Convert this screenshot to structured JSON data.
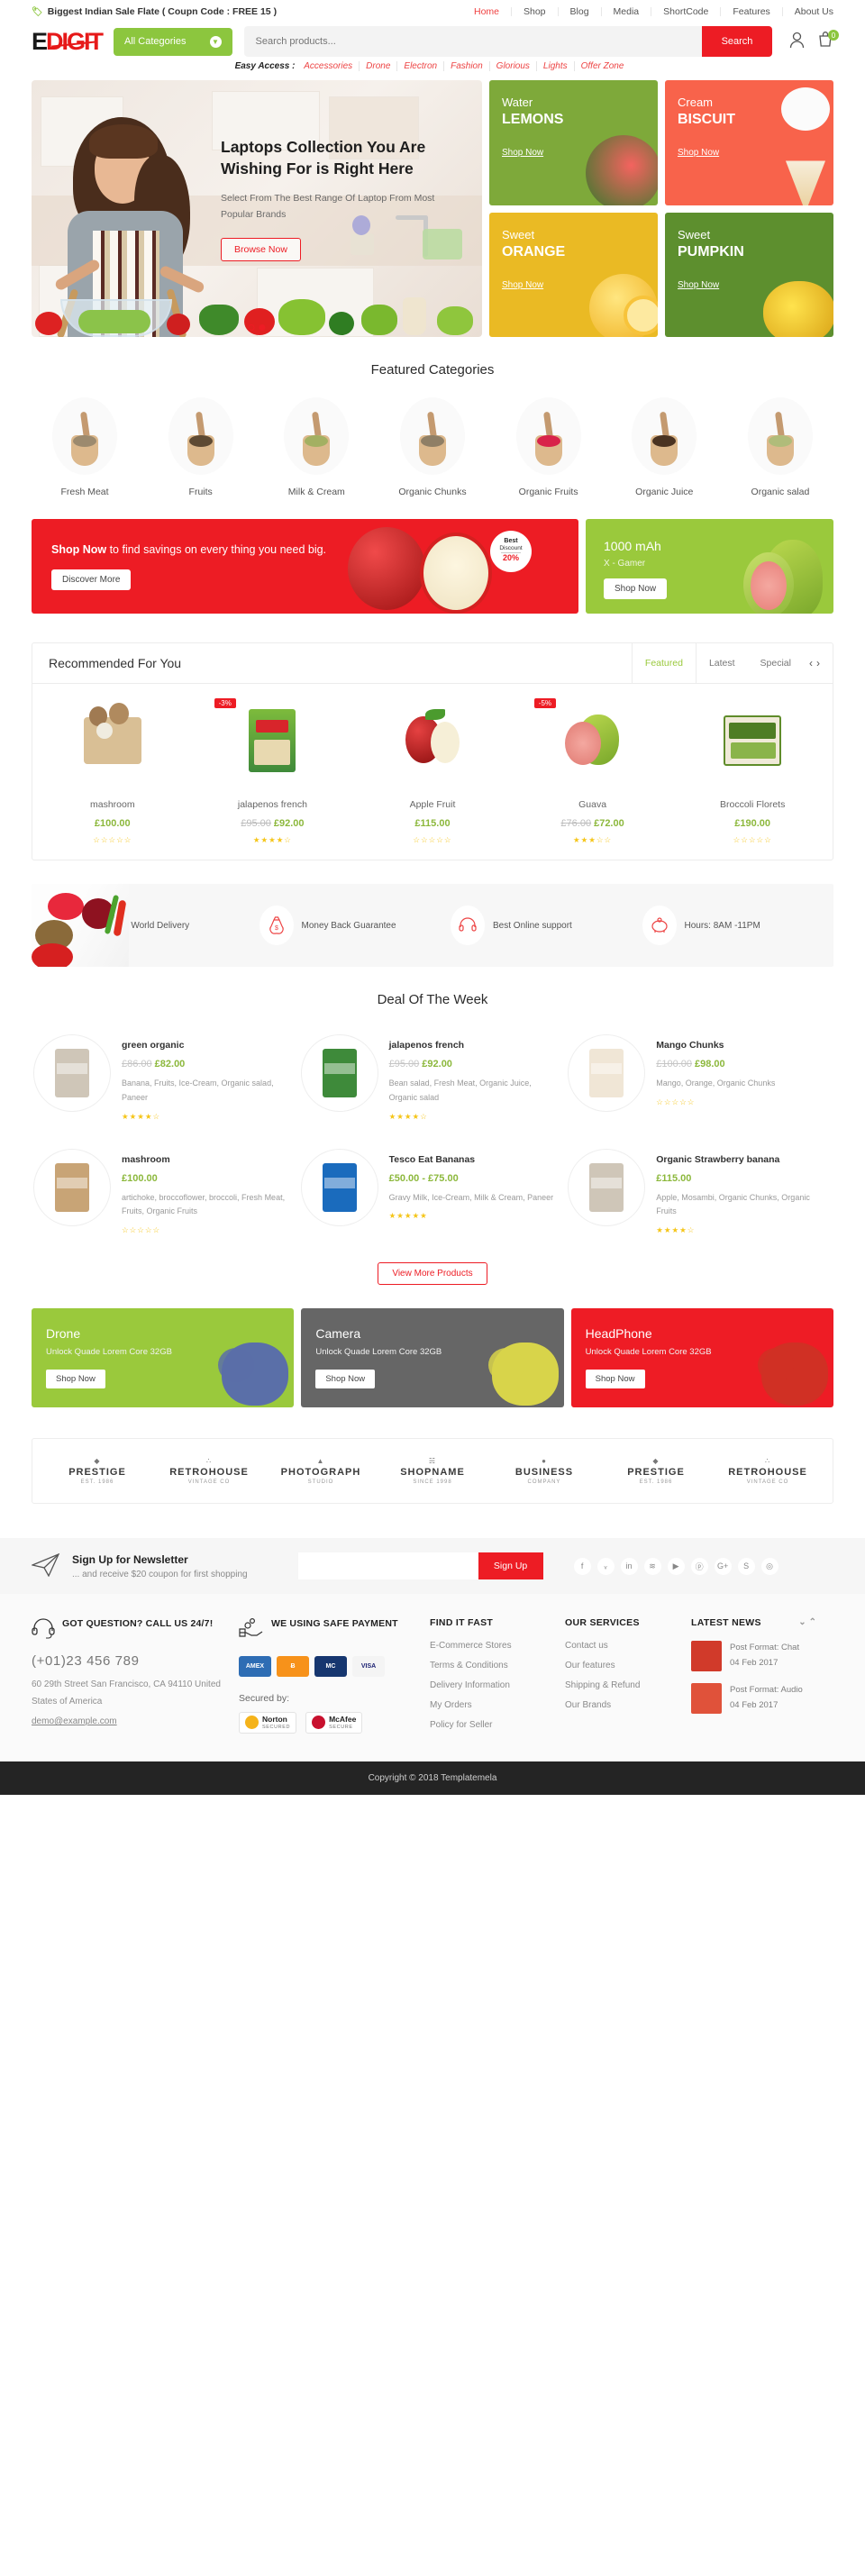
{
  "topbar": {
    "announcement": "Biggest Indian Sale Flate ( Coupn Code : FREE 15 )",
    "nav": [
      {
        "label": "Home",
        "active": true
      },
      {
        "label": "Shop",
        "active": false
      },
      {
        "label": "Blog",
        "active": false
      },
      {
        "label": "Media",
        "active": false
      },
      {
        "label": "ShortCode",
        "active": false
      },
      {
        "label": "Features",
        "active": false
      },
      {
        "label": "About Us",
        "active": false
      }
    ]
  },
  "header": {
    "logo_e": "E",
    "logo_rest": "DIGIT",
    "category_label": "All Categories",
    "search_placeholder": "Search products...",
    "search_value": "",
    "search_button": "Search",
    "cart_count": "0"
  },
  "easy_access": {
    "label": "Easy Access :",
    "links": [
      "Accessories",
      "Drone",
      "Electron",
      "Fashion",
      "Glorious",
      "Lights",
      "Offer Zone"
    ]
  },
  "hero": {
    "heading": "Laptops Collection You Are Wishing For is Right Here",
    "subtext": "Select From The Best Range Of Laptop From Most Popular Brands",
    "button": "Browse Now"
  },
  "promos": [
    {
      "small": "Water",
      "big": "LEMONS",
      "cta": "Shop Now",
      "color": "#7ea93a"
    },
    {
      "small": "Cream",
      "big": "BISCUIT",
      "cta": "Shop Now",
      "color": "#f8634b"
    },
    {
      "small": "Sweet",
      "big": "ORANGE",
      "cta": "Shop Now",
      "color": "#eaba24"
    },
    {
      "small": "Sweet",
      "big": "PUMPKIN",
      "cta": "Shop Now",
      "color": "#5d8f2e"
    }
  ],
  "featured": {
    "title": "Featured Categories",
    "items": [
      {
        "label": "Fresh Meat",
        "color": "#9c8a6e"
      },
      {
        "label": "Fruits",
        "color": "#5e4a33"
      },
      {
        "label": "Milk & Cream",
        "color": "#a3b062"
      },
      {
        "label": "Organic Chunks",
        "color": "#8f7f66"
      },
      {
        "label": "Organic Fruits",
        "color": "#d8234a"
      },
      {
        "label": "Organic Juice",
        "color": "#4a3322"
      },
      {
        "label": "Organic salad",
        "color": "#b0bc7a"
      }
    ]
  },
  "big_promo": {
    "left_text_bold": "Shop Now",
    "left_text": " to find savings on every thing you need big.",
    "left_button": "Discover More",
    "badge_line1": "Best",
    "badge_line2": "Discount",
    "badge_value": "20%",
    "right_title": "1000 mAh",
    "right_sub": "X - Gamer",
    "right_button": "Shop Now"
  },
  "recommended": {
    "title": "Recommended For You",
    "tabs": [
      {
        "label": "Featured",
        "active": true
      },
      {
        "label": "Latest",
        "active": false
      },
      {
        "label": "Special",
        "active": false
      }
    ],
    "prev": "‹",
    "next": "›",
    "products": [
      {
        "name": "mashroom",
        "price": "£100.00",
        "old_price": "",
        "discount": "",
        "stars": 0
      },
      {
        "name": "jalapenos french",
        "price": "£92.00",
        "old_price": "£95.00",
        "discount": "-3%",
        "stars": 4
      },
      {
        "name": "Apple Fruit",
        "price": "£115.00",
        "old_price": "",
        "discount": "",
        "stars": 0
      },
      {
        "name": "Guava",
        "price": "£72.00",
        "old_price": "£76.00",
        "discount": "-5%",
        "stars": 3
      },
      {
        "name": "Broccoli Florets",
        "price": "£190.00",
        "old_price": "",
        "discount": "",
        "stars": 0
      }
    ]
  },
  "services": [
    {
      "label": "Free World Delivery",
      "icon": "truck-icon"
    },
    {
      "label": "Money Back Guarantee",
      "icon": "money-bag-icon"
    },
    {
      "label": "Best Online support",
      "icon": "headset-icon"
    },
    {
      "label": "Hours: 8AM -11PM",
      "icon": "piggy-bank-icon"
    }
  ],
  "deals": {
    "title": "Deal Of The Week",
    "items": [
      {
        "name": "green organic",
        "price": "£82.00",
        "old_price": "£86.00",
        "cats": "Banana, Fruits, Ice-Cream, Organic salad, Paneer",
        "stars": 4,
        "img": "#cfc6b8"
      },
      {
        "name": "jalapenos french",
        "price": "£92.00",
        "old_price": "£95.00",
        "cats": "Bean salad, Fresh Meat, Organic Juice, Organic salad",
        "stars": 4,
        "img": "#3e8a3a"
      },
      {
        "name": "Mango Chunks",
        "price": "£98.00",
        "old_price": "£100.00",
        "cats": "Mango, Orange, Organic Chunks",
        "stars": 0,
        "img": "#f0e6d6"
      },
      {
        "name": "mashroom",
        "price": "£100.00",
        "old_price": "",
        "cats": "artichoke, broccoflower, broccoli, Fresh Meat, Fruits, Organic Fruits",
        "stars": 0,
        "img": "#c8a476"
      },
      {
        "name": "Tesco Eat Bananas",
        "price": "£50.00 - £75.00",
        "old_price": "",
        "cats": "Gravy Milk, Ice-Cream, Milk & Cream, Paneer",
        "stars": 5,
        "img": "#1a6bbd"
      },
      {
        "name": "Organic Strawberry banana",
        "price": "£115.00",
        "old_price": "",
        "cats": "Apple, Mosambi, Organic Chunks, Organic Fruits",
        "stars": 4,
        "img": "#cfc6b8"
      }
    ],
    "view_more": "View More Products"
  },
  "cat_banners": [
    {
      "title": "Drone",
      "sub": "Unlock Quade Lorem Core 32GB",
      "cta": "Shop Now",
      "color": "#9ac93c",
      "fruit": "#5a6fa8"
    },
    {
      "title": "Camera",
      "sub": "Unlock Quade Lorem Core 32GB",
      "cta": "Shop Now",
      "color": "#666666",
      "fruit": "#d8d44a"
    },
    {
      "title": "HeadPhone",
      "sub": "Unlock Quade Lorem Core 32GB",
      "cta": "Shop Now",
      "color": "#ee1c25",
      "fruit": "#d03024"
    }
  ],
  "brands": [
    {
      "mark": "◆",
      "name": "PRESTIGE",
      "sub": "EST. 1986"
    },
    {
      "mark": "∴",
      "name": "RETROHOUSE",
      "sub": "VINTAGE CO"
    },
    {
      "mark": "▲",
      "name": "PHOTOGRAPH",
      "sub": "STUDIO"
    },
    {
      "mark": "☵",
      "name": "SHOPNAME",
      "sub": "SINCE 1998"
    },
    {
      "mark": "●",
      "name": "BUSINESS",
      "sub": "COMPANY"
    },
    {
      "mark": "◆",
      "name": "PRESTIGE",
      "sub": "EST. 1986"
    },
    {
      "mark": "∴",
      "name": "RETROHOUSE",
      "sub": "VINTAGE CO"
    }
  ],
  "newsletter": {
    "title": "Sign Up for Newsletter",
    "sub": "... and receive $20 coupon for first shopping",
    "input_placeholder": "",
    "input_value": "",
    "button": "Sign Up",
    "socials": [
      "f",
      "ᵥ",
      "in",
      "≋",
      "▶",
      "ⓟ",
      "G+",
      "S",
      "◎"
    ]
  },
  "footer": {
    "contact": {
      "title": "GOT QUESTION? CALL US 24/7!",
      "phone": "(+01)23 456 789",
      "address": "60 29th Street San Francisco, CA 94110 United States of America",
      "email": "demo@example.com"
    },
    "payment": {
      "title": "WE USING SAFE PAYMENT",
      "cards": [
        {
          "label": "AMEX",
          "color": "#2e6db4"
        },
        {
          "label": "Ƀ",
          "color": "#f7921a"
        },
        {
          "label": "MC",
          "color": "#16366f"
        },
        {
          "label": "VISA",
          "color": "#f4f4f4",
          "text": "#1a1f71"
        }
      ],
      "secured_label": "Secured by:",
      "seals": [
        {
          "name": "Norton",
          "sub": "SECURED"
        },
        {
          "name": "McAfee",
          "sub": "SECURE"
        }
      ]
    },
    "find_it_fast": {
      "title": "FIND IT FAST",
      "links": [
        "E-Commerce Stores",
        "Terms & Conditions",
        "Delivery Information",
        "My Orders",
        "Policy for Seller"
      ]
    },
    "our_services": {
      "title": "OUR SERVICES",
      "links": [
        "Contact us",
        "Our features",
        "Shipping & Refund",
        "Our Brands"
      ]
    },
    "latest_news": {
      "title": "LATEST NEWS",
      "items": [
        {
          "title": "Post Format: Chat",
          "date": "04 Feb 2017",
          "color": "#d13a2a"
        },
        {
          "title": "Post Format: Audio",
          "date": "04 Feb 2017",
          "color": "#e0523a"
        }
      ]
    },
    "copyright": "Copyright © 2018 Templatemela"
  }
}
